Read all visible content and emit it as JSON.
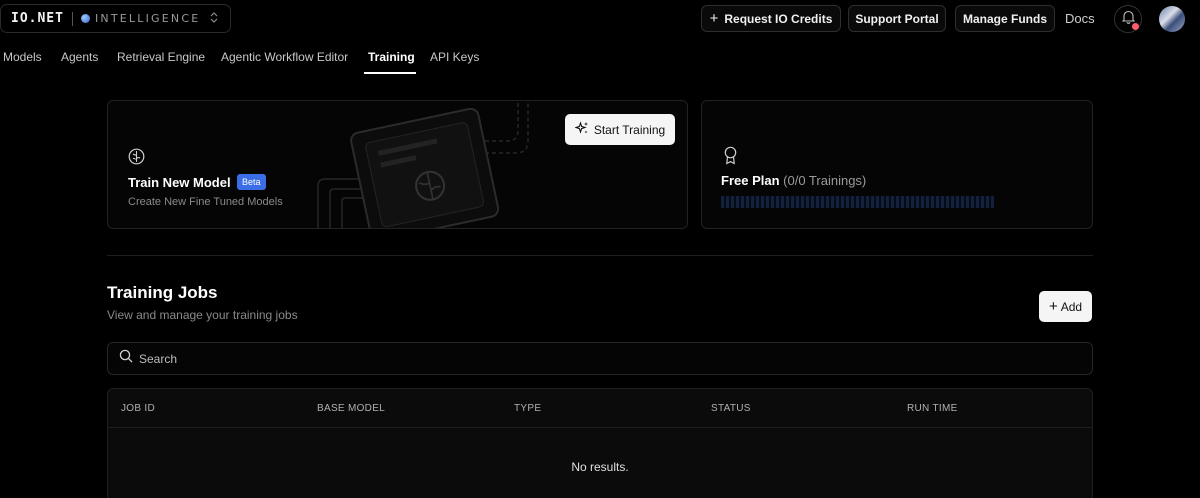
{
  "brand": {
    "logo": "IO.NET",
    "subtitle": "INTELLIGENCE",
    "switcher_icon": "chevron-up-down-icon"
  },
  "header": {
    "request_credits": "Request IO Credits",
    "support_portal": "Support Portal",
    "manage_funds": "Manage Funds",
    "docs": "Docs",
    "notification_icon": "bell-icon",
    "notification_dot_color": "#ff5a6e"
  },
  "nav": {
    "tabs": [
      {
        "label": "Models",
        "active": false
      },
      {
        "label": "Agents",
        "active": false
      },
      {
        "label": "Retrieval Engine",
        "active": false
      },
      {
        "label": "Agentic Workflow Editor",
        "active": false
      },
      {
        "label": "Training",
        "active": true
      },
      {
        "label": "API Keys",
        "active": false
      }
    ]
  },
  "train_card": {
    "icon": "brain-icon",
    "title": "Train New Model",
    "badge": "Beta",
    "badge_color": "#3b6ee6",
    "subtitle": "Create New Fine Tuned Models",
    "button": "Start Training",
    "button_icon": "sparkles-icon"
  },
  "plan_card": {
    "icon": "award-icon",
    "title": "Free Plan",
    "count": "(0/0 Trainings)",
    "progress_used": 0,
    "progress_total": 0
  },
  "jobs": {
    "title": "Training Jobs",
    "subtitle": "View and manage your training jobs",
    "add_button": "Add",
    "search_placeholder": "Search",
    "columns": [
      "JOB ID",
      "BASE MODEL",
      "TYPE",
      "STATUS",
      "RUN TIME"
    ],
    "rows": [],
    "empty_text": "No results."
  }
}
